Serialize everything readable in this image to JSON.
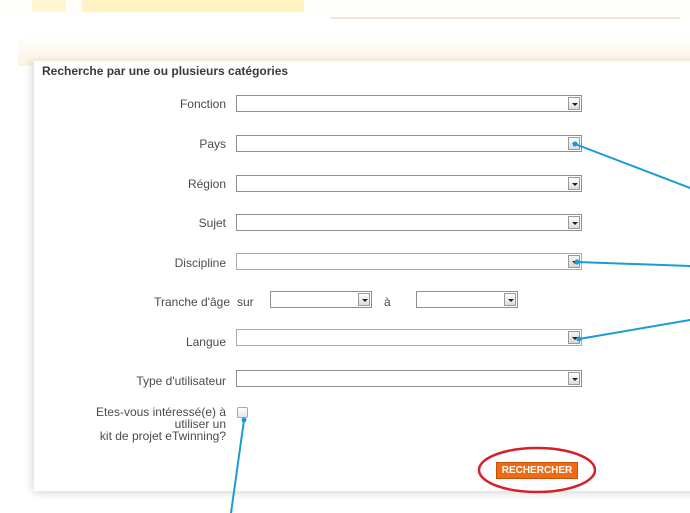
{
  "section_title": "Recherche par une ou plusieurs catégories",
  "fields": [
    {
      "label": "Fonction",
      "value": ""
    },
    {
      "label": "Pays",
      "value": ""
    },
    {
      "label": "Région",
      "value": ""
    },
    {
      "label": "Sujet",
      "value": ""
    },
    {
      "label": "Discipline",
      "value": ""
    },
    {
      "label": "Langue",
      "value": ""
    },
    {
      "label": "Type d'utilisateur",
      "value": ""
    }
  ],
  "age_range": {
    "label": "Tranche d'âge",
    "prefix": "sur",
    "from_value": "",
    "separator": "à",
    "to_value": ""
  },
  "interest": {
    "label_line1": "Etes-vous intéressé(e) à",
    "label_line2": "utiliser un",
    "label_line3": "kit de projet eTwinning?",
    "checked": false
  },
  "search_button": "RECHERCHER",
  "colors": {
    "button_orange": "#f06a16",
    "annotation_blue": "#1a9ad6",
    "annotation_red": "#d81f26"
  }
}
